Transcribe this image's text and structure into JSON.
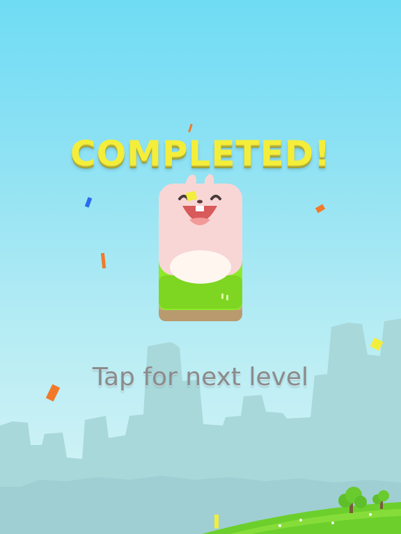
{
  "game": {
    "title": "COMPLETED!",
    "prompt": "Tap for next level"
  },
  "colors": {
    "sky_top": "#6fdcf4",
    "sky_bottom": "#d9f5f6",
    "title_fill": "#f4ee3a",
    "prompt_text": "#8b8b8b",
    "character_body": "#f8d6d6",
    "character_belly": "#fff6f0",
    "block_green": "#8fe82a",
    "block_dirt": "#b89a6e",
    "mountains": "#a6d6d8",
    "grass": "#6ecf2e",
    "confetti_orange": "#f07a2a",
    "confetti_yellow": "#f2ee3c",
    "confetti_blue": "#2a6cf0"
  },
  "icons": {
    "character": "smiling-bunny-icon",
    "tree": "tree-icon"
  }
}
